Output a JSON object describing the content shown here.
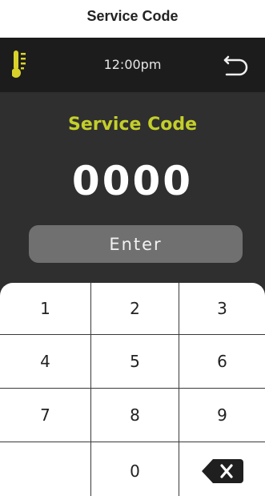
{
  "page": {
    "title": "Service Code"
  },
  "statusbar": {
    "time": "12:00pm",
    "left_icon": "thermometer-icon",
    "right_icon": "back-arrow-icon"
  },
  "main": {
    "heading": "Service Code",
    "code_value": "0000",
    "enter_label": "Enter"
  },
  "keypad": {
    "keys": [
      "1",
      "2",
      "3",
      "4",
      "5",
      "6",
      "7",
      "8",
      "9",
      "",
      "0"
    ],
    "backspace_icon": "backspace-icon"
  },
  "colors": {
    "accent_green": "#c4cf2a",
    "thermo_yellow": "#d9d22a",
    "background_dark": "#2f2f2f",
    "statusbar_dark": "#1c1c1c",
    "button_gray": "#707070"
  }
}
